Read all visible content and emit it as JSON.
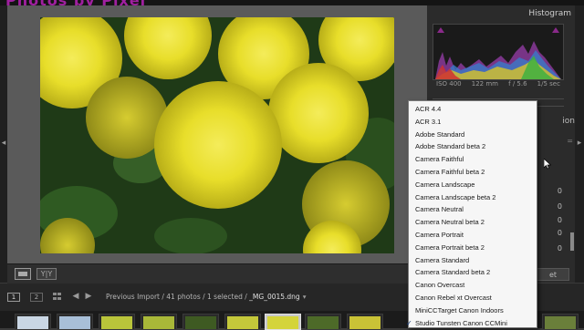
{
  "header": {
    "brand": "Photos by Pixel"
  },
  "histogram": {
    "title": "Histogram",
    "iso": "ISO 400",
    "focal": "122 mm",
    "aperture": "f / 5.6",
    "shutter": "1/5 sec"
  },
  "right_panel": {
    "section_label": "ion",
    "section_sub": "=",
    "values": [
      "0",
      "0",
      "0",
      "0",
      "0"
    ],
    "export_label": "et"
  },
  "filmstrip": {
    "btn1": "1",
    "btn2": "2",
    "source": "Previous Import / 41 photos / 1 selected /",
    "filename": "_MG_0015.dng"
  },
  "toolbar": {
    "compare_label": "Y|Y"
  },
  "profile_menu": {
    "items": [
      "ACR 4.4",
      "ACR 3.1",
      "Adobe Standard",
      "Adobe Standard beta 2",
      "Camera Faithful",
      "Camera Faithful beta 2",
      "Camera Landscape",
      "Camera Landscape beta 2",
      "Camera Neutral",
      "Camera Neutral beta 2",
      "Camera Portrait",
      "Camera Portrait beta 2",
      "Camera Standard",
      "Camera Standard beta 2",
      "Canon Overcast",
      "Canon Rebel xt Overcast",
      "MiniCCTarget Canon Indoors",
      "Studio Tunsten Canon CCMini"
    ],
    "checked_item": "Studio Tunsten Canon CCMini"
  },
  "colors": {
    "accent": "#a020a0",
    "flower_yellow": "#f0e826",
    "foliage": "#1f3a17"
  }
}
